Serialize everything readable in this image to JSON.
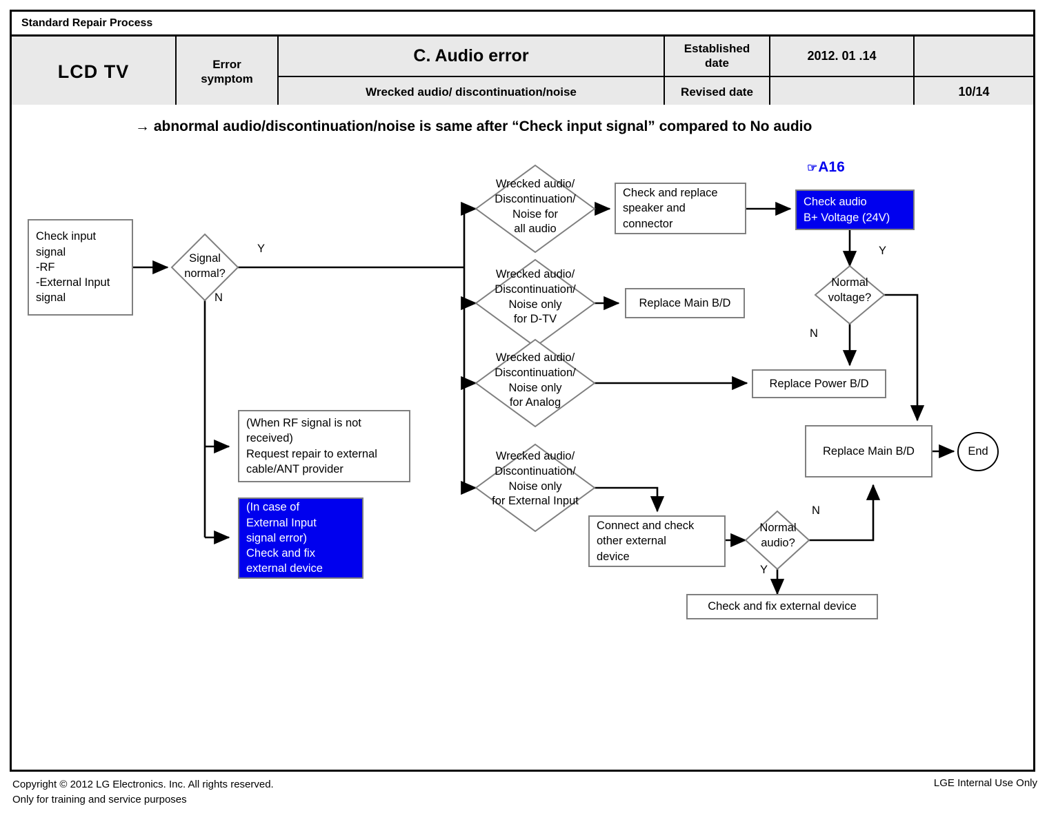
{
  "header": {
    "process_label": "Standard Repair Process",
    "model": "LCD  TV",
    "error_symptom_label": "Error\nsymptom",
    "error_symptom_label_line1": "Error",
    "error_symptom_label_line2": "symptom",
    "error_title": "C. Audio error",
    "error_subtitle": "Wrecked audio/ discontinuation/noise",
    "established_date_label_line1": "Established",
    "established_date_label_line2": "date",
    "revised_date_label": "Revised date",
    "established_date_value": "2012. 01 .14",
    "revised_date_value": "",
    "page_number": "10/14"
  },
  "subtitle": "→ abnormal audio/discontinuation/noise is same after “Check input signal” compared to No audio",
  "ref_tag": {
    "icon": "pointing-hand-icon",
    "glyph": "☞",
    "label": "A16",
    "color": "#0000ee"
  },
  "nodes": {
    "check_input_signal": "Check input\nsignal\n-RF\n-External Input\nsignal",
    "signal_normal": "Signal\nnormal?",
    "rf_not_received": "(When RF signal is not\nreceived)\nRequest repair to external\ncable/ANT provider",
    "external_input_error": "(In case of\nExternal Input\nsignal error)\nCheck and fix\nexternal device",
    "d_all_audio": "Wrecked audio/\nDiscontinuation/\nNoise for\nall audio",
    "d_dtv": "Wrecked audio/\nDiscontinuation/\nNoise only\nfor D-TV",
    "d_analog": "Wrecked audio/\nDiscontinuation/\nNoise only\nfor Analog",
    "d_external": "Wrecked audio/\nDiscontinuation/\nNoise only\nfor External Input",
    "check_replace_speaker": "Check and replace\nspeaker and\nconnector",
    "replace_main_bd_top": "Replace Main B/D",
    "check_audio_bplus": "Check audio\nB+ Voltage (24V)",
    "normal_voltage": "Normal\nvoltage?",
    "replace_power_bd": "Replace Power B/D",
    "replace_main_bd_right": "Replace Main B/D",
    "end": "End",
    "connect_check_other": "Connect and check\nother external\ndevice",
    "normal_audio": "Normal\naudio?",
    "check_fix_external": "Check and fix external device"
  },
  "edge_labels": {
    "signal_normal_yes": "Y",
    "signal_normal_no": "N",
    "normal_voltage_yes": "Y",
    "normal_voltage_no": "N",
    "normal_audio_yes": "Y",
    "normal_audio_no": "N"
  },
  "footer": {
    "copyright_line1": "Copyright © 2012 LG Electronics. Inc. All rights reserved.",
    "copyright_line2": "Only for training and service purposes",
    "internal_use": "LGE Internal Use Only"
  },
  "colors": {
    "highlight_blue": "#0000ee",
    "node_border": "#7f7f7f",
    "header_fill": "#e9e9e9",
    "frame": "#000000"
  }
}
